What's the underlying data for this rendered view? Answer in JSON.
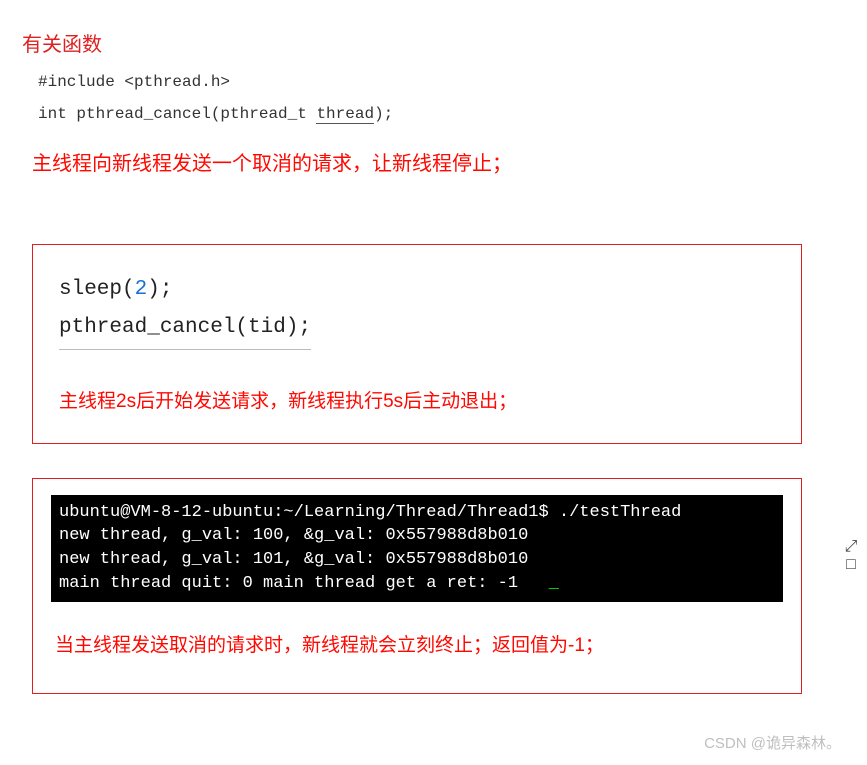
{
  "section_title": "有关函数",
  "code_include": "#include <pthread.h>",
  "code_proto_prefix": "int pthread_cancel(pthread_t ",
  "code_proto_underlined": "thread",
  "code_proto_suffix": ");",
  "note1": "主线程向新线程发送一个取消的请求，让新线程停止；",
  "box1": {
    "code_line1_pre": "sleep(",
    "code_line1_num": "2",
    "code_line1_post": ");",
    "code_line2": "pthread_cancel(tid);",
    "note": "主线程2s后开始发送请求，新线程执行5s后主动退出；"
  },
  "box2": {
    "terminal_l1": "ubuntu@VM-8-12-ubuntu:~/Learning/Thread/Thread1$ ./testThread",
    "terminal_l2": "new thread, g_val: 100, &g_val: 0x557988d8b010",
    "terminal_l3": "new thread, g_val: 101, &g_val: 0x557988d8b010",
    "terminal_l4": "main thread quit: 0 main thread get a ret: -1   ",
    "note": "当主线程发送取消的请求时，新线程就会立刻终止；返回值为-1；"
  },
  "side_icon": "⤢\n□",
  "watermark": "CSDN @诡异森林。"
}
